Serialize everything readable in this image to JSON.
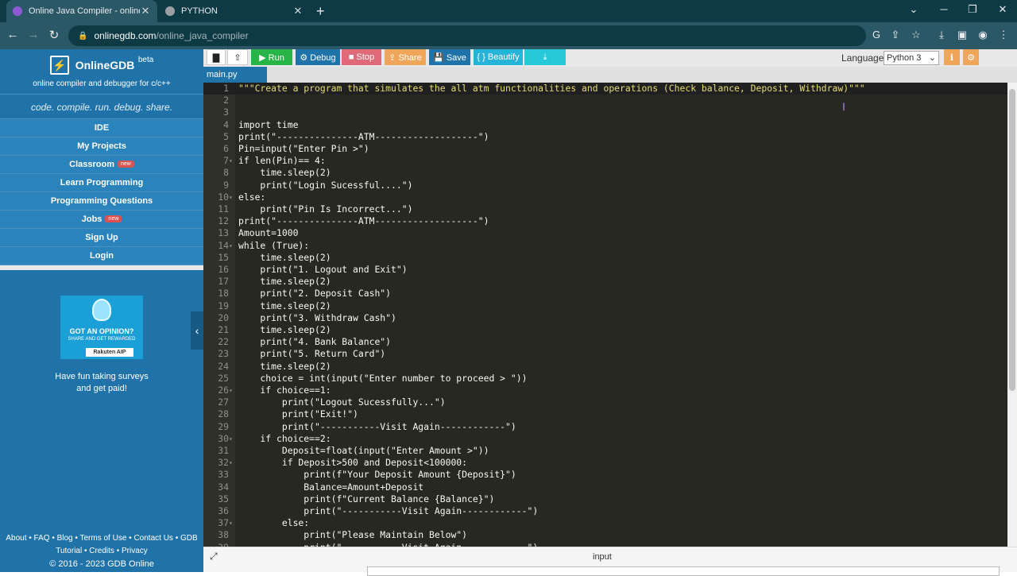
{
  "browser": {
    "tabs": [
      {
        "title": "Online Java Compiler - online ed",
        "active": true,
        "favicon_color": "#8c5bd4"
      },
      {
        "title": "PYTHON",
        "active": false,
        "favicon_color": "#9aa0a6"
      }
    ],
    "url_host": "onlinegdb.com",
    "url_path": "/online_java_compiler"
  },
  "sidebar": {
    "brand": "OnlineGDB",
    "beta": "beta",
    "subtitle": "online compiler and debugger for c/c++",
    "tagline": "code. compile. run. debug. share.",
    "menu": [
      {
        "label": "IDE",
        "badge": ""
      },
      {
        "label": "My Projects",
        "badge": ""
      },
      {
        "label": "Classroom",
        "badge": "new"
      },
      {
        "label": "Learn Programming",
        "badge": ""
      },
      {
        "label": "Programming Questions",
        "badge": ""
      },
      {
        "label": "Jobs",
        "badge": "new"
      },
      {
        "label": "Sign Up",
        "badge": ""
      },
      {
        "label": "Login",
        "badge": ""
      }
    ],
    "ad": {
      "headline": "GOT AN OPINION?",
      "subline": "SHARE AND GET REWARDED",
      "brand": "Rakuten AIP",
      "caption_line1": "Have fun taking surveys",
      "caption_line2": "and get paid!"
    },
    "footer_line1": "About • FAQ • Blog • Terms of Use • Contact Us • GDB",
    "footer_line2": "Tutorial • Credits • Privacy",
    "copyright": "© 2016 - 2023 GDB Online"
  },
  "toolbar": {
    "run": "▶ Run",
    "debug": "⚙ Debug",
    "stop": "■ Stop",
    "share": "⇪ Share",
    "save": "💾 Save",
    "beautify": "{ } Beautify",
    "download": "⤓",
    "language_label": "Language",
    "language_value": "Python 3"
  },
  "file_tab": "main.py",
  "editor": {
    "lines": [
      "\"\"\"Create a program that simulates the all atm functionalities and operations (Check balance, Deposit, Withdraw)\"\"\"",
      "",
      "",
      "import time",
      "print(\"---------------ATM-------------------\")",
      "Pin=input(\"Enter Pin >\")",
      "if len(Pin)== 4:",
      "    time.sleep(2)",
      "    print(\"Login Sucessful....\")",
      "else:",
      "    print(\"Pin Is Incorrect...\")",
      "print(\"---------------ATM-------------------\")",
      "Amount=1000",
      "while (True):",
      "    time.sleep(2)",
      "    print(\"1. Logout and Exit\")",
      "    time.sleep(2)",
      "    print(\"2. Deposit Cash\")",
      "    time.sleep(2)",
      "    print(\"3. Withdraw Cash\")",
      "    time.sleep(2)",
      "    print(\"4. Bank Balance\")",
      "    print(\"5. Return Card\")",
      "    time.sleep(2)",
      "    choice = int(input(\"Enter number to proceed > \"))",
      "    if choice==1:",
      "        print(\"Logout Sucessfully...\")",
      "        print(\"Exit!\")",
      "        print(\"-----------Visit Again------------\")",
      "    if choice==2:",
      "        Deposit=float(input(\"Enter Amount >\"))",
      "        if Deposit>500 and Deposit<100000:",
      "            print(f\"Your Deposit Amount {Deposit}\")",
      "            Balance=Amount+Deposit",
      "            print(f\"Current Balance {Balance}\")",
      "            print(\"-----------Visit Again------------\")",
      "        else:",
      "            print(\"Please Maintain Below\")",
      "            print(\"-----------Visit Again------------\")"
    ],
    "fold_lines": [
      7,
      10,
      14,
      26,
      30,
      32,
      37
    ]
  },
  "bottom": {
    "input_label": "input"
  }
}
